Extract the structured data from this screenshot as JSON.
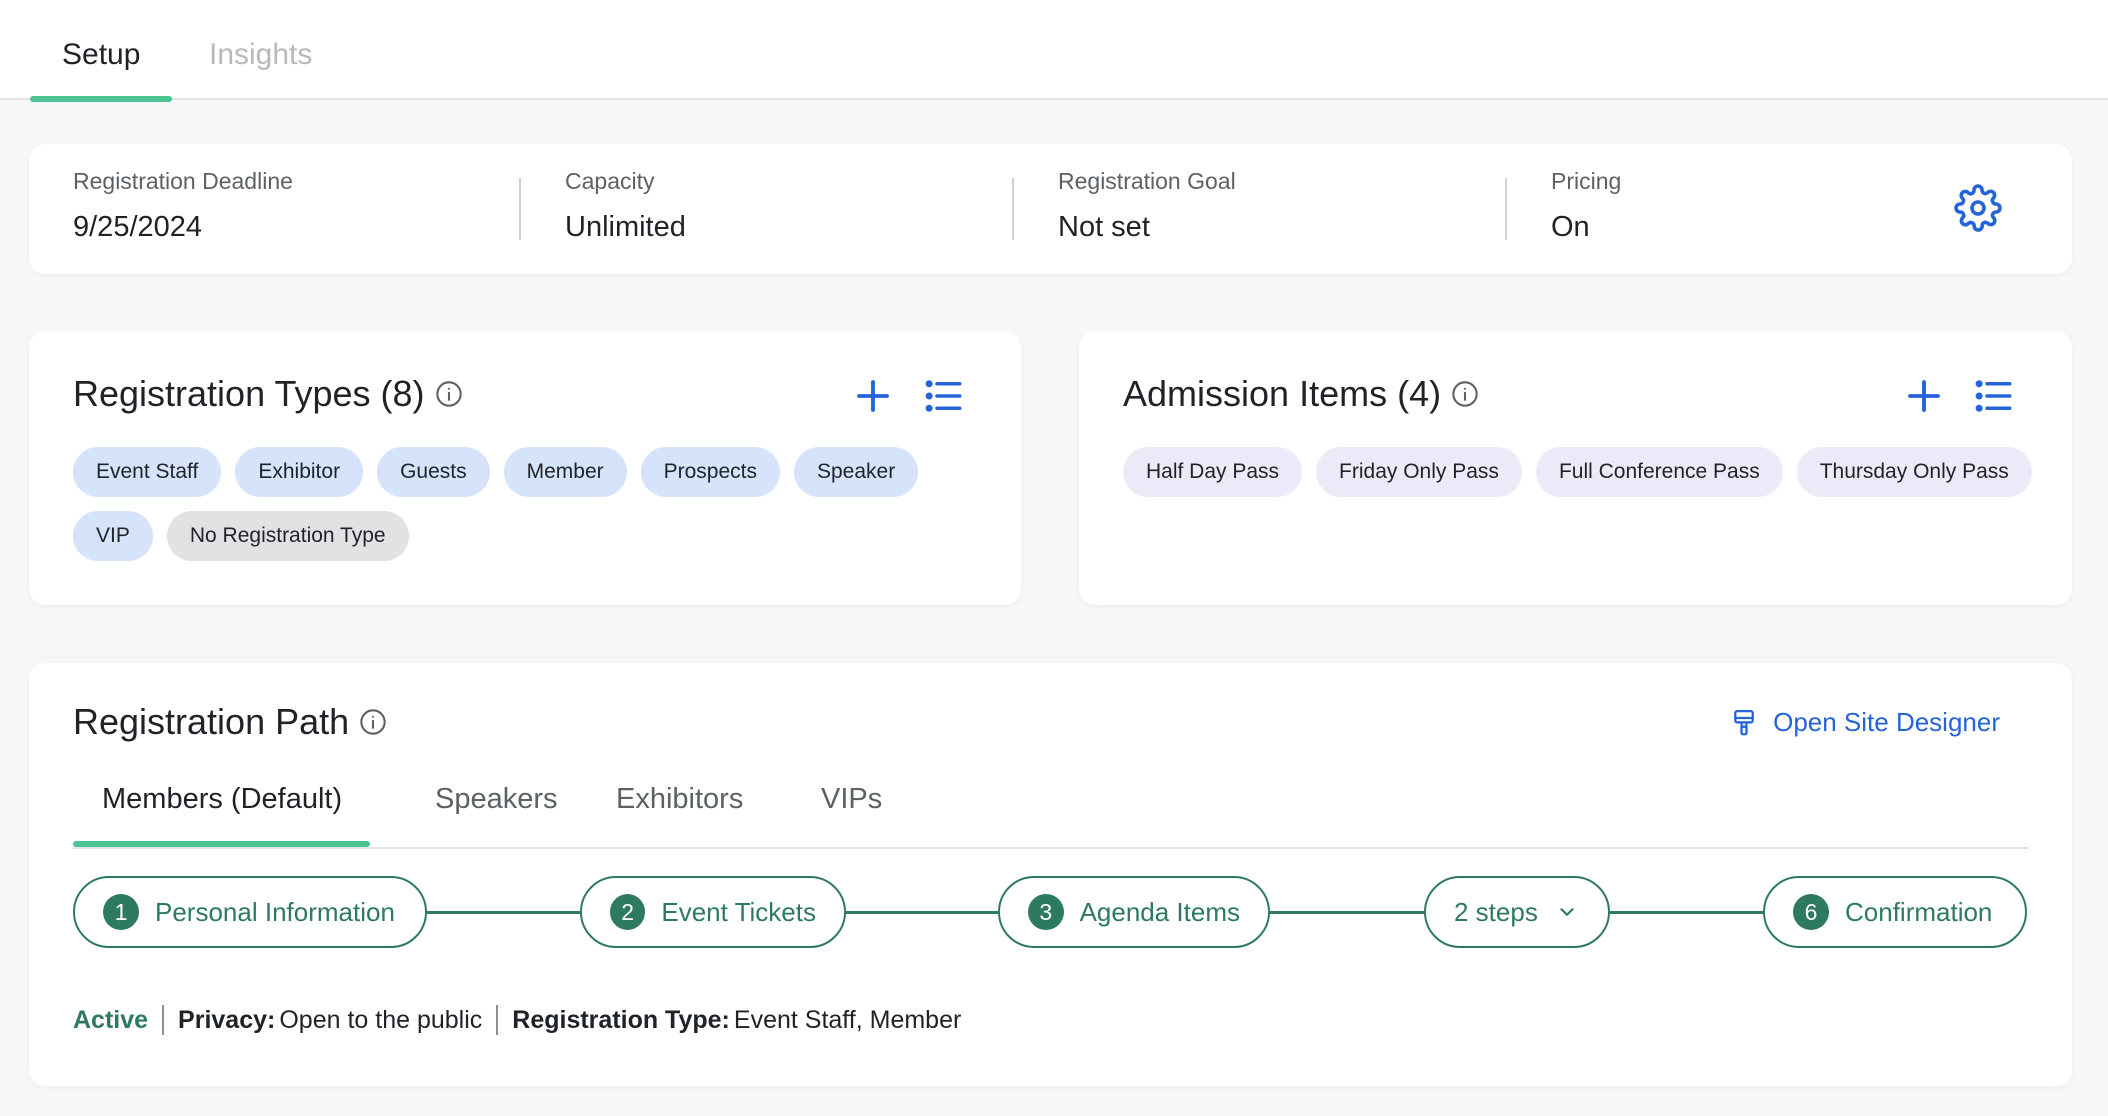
{
  "tabs": [
    {
      "label": "Setup",
      "active": true
    },
    {
      "label": "Insights",
      "active": false
    }
  ],
  "summary": {
    "deadline": {
      "label": "Registration Deadline",
      "value": "9/25/2024"
    },
    "capacity": {
      "label": "Capacity",
      "value": "Unlimited"
    },
    "goal": {
      "label": "Registration Goal",
      "value": "Not set"
    },
    "pricing": {
      "label": "Pricing",
      "value": "On"
    },
    "settings_icon": "gear-icon"
  },
  "registration_types": {
    "title": "Registration Types (8)",
    "chips": [
      "Event Staff",
      "Exhibitor",
      "Guests",
      "Member",
      "Prospects",
      "Speaker",
      "VIP"
    ],
    "none_chip": "No Registration Type"
  },
  "admission_items": {
    "title": "Admission Items (4)",
    "chips": [
      "Half Day Pass",
      "Friday Only Pass",
      "Full Conference Pass",
      "Thursday Only Pass"
    ]
  },
  "registration_path": {
    "title": "Registration Path",
    "site_designer_label": "Open Site Designer",
    "tabs": [
      "Members (Default)",
      "Speakers",
      "Exhibitors",
      "VIPs"
    ],
    "steps": [
      {
        "number": "1",
        "label": "Personal Information"
      },
      {
        "number": "2",
        "label": "Event Tickets"
      },
      {
        "number": "3",
        "label": "Agenda Items"
      },
      {
        "number": "",
        "label": "2 steps"
      },
      {
        "number": "6",
        "label": "Confirmation"
      }
    ],
    "status": {
      "active_label": "Active",
      "privacy_label": "Privacy:",
      "privacy_value": "Open to the public",
      "type_label": "Registration Type:",
      "type_value": "Event Staff, Member"
    }
  },
  "colors": {
    "accent_blue": "#2563d8",
    "accent_green": "#2e7a5e",
    "tab_underline": "#4cc391",
    "chip_blue": "#d6e4fb",
    "chip_purple": "#ede9f8",
    "chip_grey": "#e1e2e4"
  }
}
